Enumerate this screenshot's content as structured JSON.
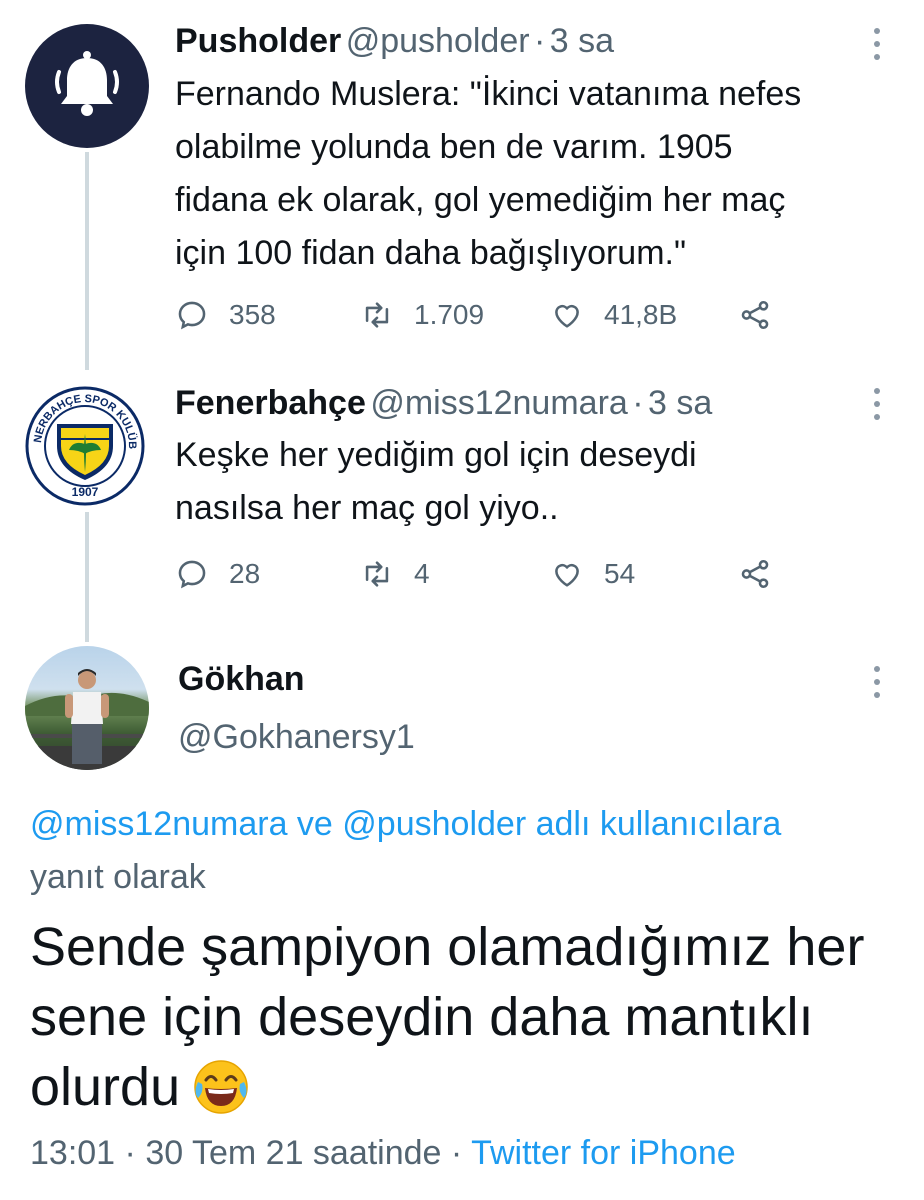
{
  "tweets": [
    {
      "display_name": "Pusholder",
      "handle": "@pusholder",
      "time": "3 sa",
      "text_lines": [
        "Fernando Muslera: \"İkinci vatanıma nefes",
        "olabilme yolunda ben de varım. 1905",
        "fidana ek olarak, gol yemediğim her maç",
        "için 100 fidan daha bağışlıyorum.\""
      ],
      "replies": "358",
      "retweets": "1.709",
      "likes": "41,8B",
      "avatar_icon": "bell-icon"
    },
    {
      "display_name": "Fenerbahçe",
      "handle": "@miss12numara",
      "time": "3 sa",
      "text_lines": [
        "Keşke her yediğim gol için deseydi",
        "nasılsa her maç gol yiyo.."
      ],
      "replies": "28",
      "retweets": "4",
      "likes": "54",
      "logo_ring_text": "FENERBAHÇE SPOR KULÜBÜ",
      "logo_year": "1907"
    }
  ],
  "main_tweet": {
    "display_name": "Gökhan",
    "handle": "@Gokhanersy1",
    "reply_to_mentions": "@miss12numara ve @pusholder adlı kullanıcılara",
    "reply_to_suffix": "yanıt olarak",
    "text_lines": [
      "Sende şampiyon olamadığımız her",
      "sene için deseydin daha mantıklı",
      "olurdu"
    ],
    "emoji": "😂",
    "time": "13:01",
    "date": "30 Tem 21 saatinde",
    "source": "Twitter for iPhone"
  },
  "colors": {
    "accent": "#1d9bf0",
    "text": "#0f1419",
    "muted": "#536471",
    "pusholder_avatar_bg": "#1c2340",
    "fb_navy": "#0b2a66",
    "fb_yellow": "#f7d417"
  }
}
